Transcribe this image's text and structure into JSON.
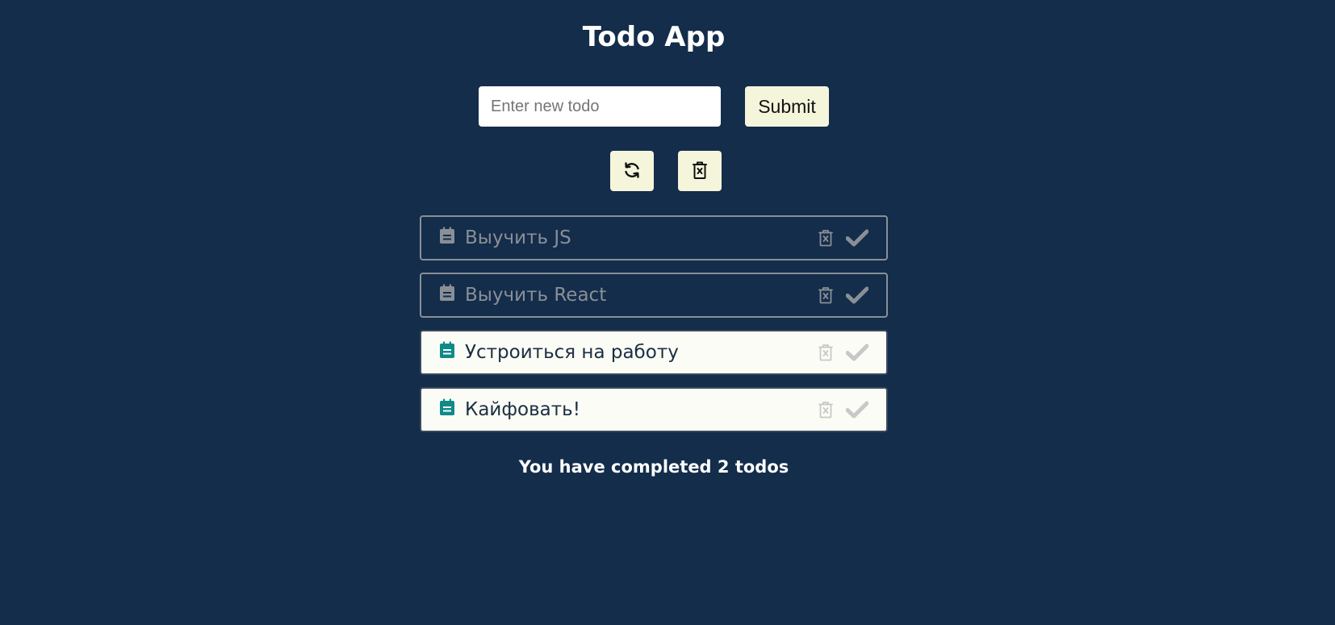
{
  "app": {
    "title": "Todo App"
  },
  "form": {
    "input_placeholder": "Enter new todo",
    "input_value": "",
    "submit_label": "Submit"
  },
  "toolbar": {
    "refresh_icon": "refresh-icon",
    "clear_icon": "trash-x-icon"
  },
  "todos": [
    {
      "text": "Выучить JS",
      "completed": true
    },
    {
      "text": "Выучить React",
      "completed": true
    },
    {
      "text": "Устроиться на работу",
      "completed": false
    },
    {
      "text": "Кайфовать!",
      "completed": false
    }
  ],
  "summary": {
    "text": "You have completed 2 todos"
  },
  "colors": {
    "background": "#132d4b",
    "button": "#f5f5dc",
    "active_item_bg": "#fbfcf5",
    "active_icon": "#0f8a8a",
    "completed_gray": "#8a8f96",
    "active_action_gray": "#c8c8c8"
  }
}
